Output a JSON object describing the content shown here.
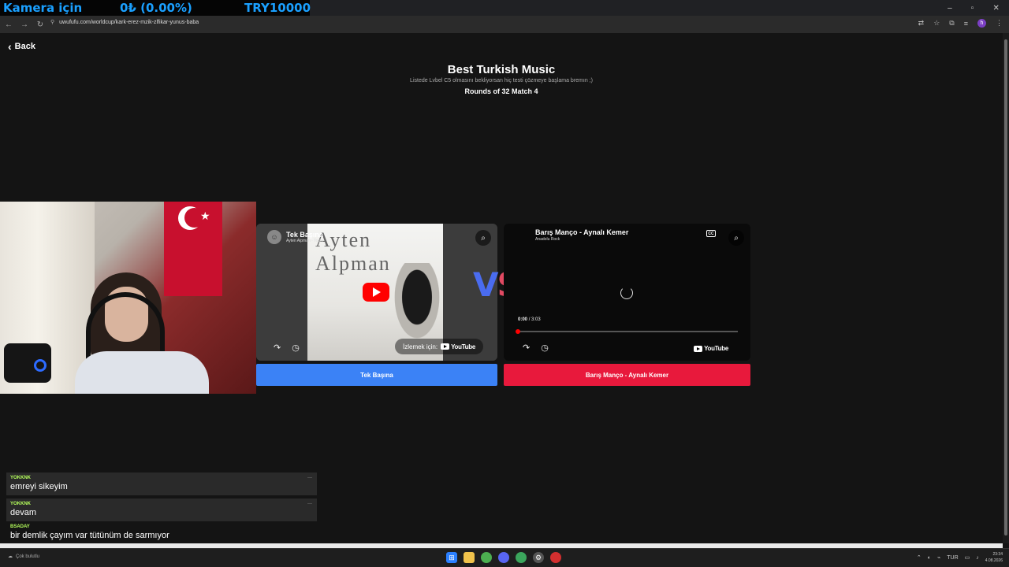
{
  "overlay": {
    "ticker_label": "Kamera için",
    "ticker_value": "0₺ (0.00%)",
    "ticker_goal": "TRY10000"
  },
  "browser": {
    "url": "uwufufu.com/worldcup/kark-erez-mzik-zlfikar-yunus-baba",
    "profile_initial": "h"
  },
  "page": {
    "back_label": "Back",
    "title": "Best Turkish Music",
    "subtitle": "Listede Lvbel C5 olmasını bekliyorsan hiç testi çözmeye başlama bremın ;)",
    "round": "Rounds of 32 Match 4",
    "vs_v": "V",
    "vs_s": "S"
  },
  "left_video": {
    "title": "Tek Başına",
    "channel": "Ayten Alpman - Topic",
    "art_text": "Ayten Alpman",
    "watch_on": "İzlemek için:",
    "youtube": "YouTube",
    "vote_label": "Tek Başına"
  },
  "right_video": {
    "title": "Barış Manço - Aynalı Kemer",
    "channel": "Anadolu Rock",
    "cc": "CC",
    "time_current": "0:00",
    "time_total": "/ 3:03",
    "youtube": "YouTube",
    "vote_label": "Barış Manço - Aynalı Kemer",
    "progress": 0.0
  },
  "chat": {
    "messages": [
      {
        "user": "YOKKNK",
        "text": "emreyi sikeyim"
      },
      {
        "user": "YOKKNK",
        "text": "devam"
      },
      {
        "user": "BSADAY",
        "text": "bir demlik çayım var tütünüm de sarmıyor"
      }
    ]
  },
  "taskbar": {
    "weather": "Çok bulutlu",
    "lang": "TUR",
    "time": "23:34",
    "date": "4.08.2026"
  },
  "colors": {
    "vote_left": "#3b82f6",
    "vote_right": "#e8193c",
    "vs_left": "#4a6cf0",
    "vs_right": "#e24a63",
    "chat_user": "#b5ff5c"
  }
}
